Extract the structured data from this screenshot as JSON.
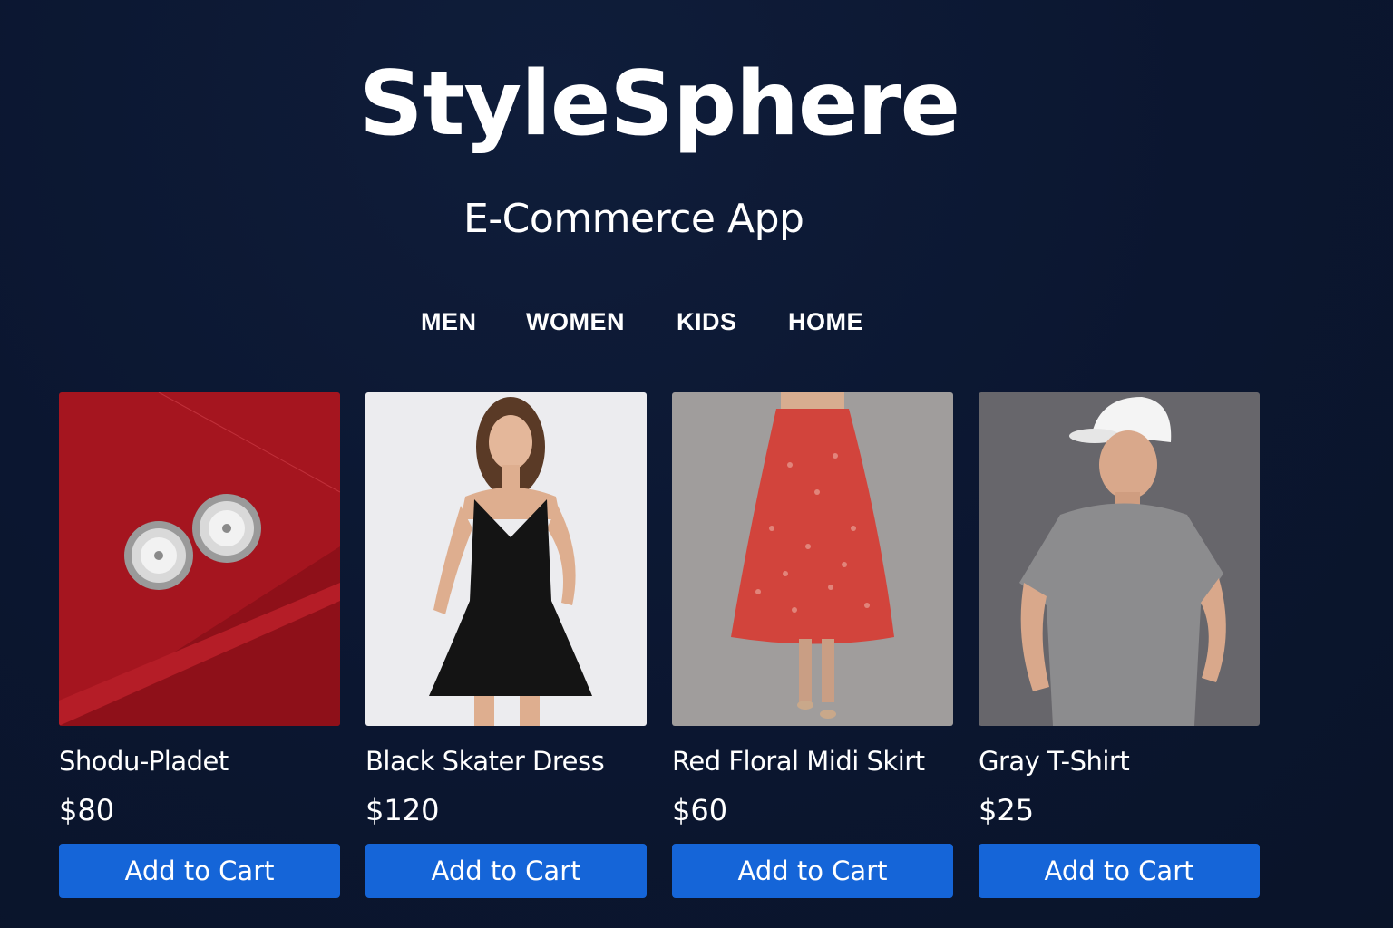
{
  "header": {
    "title": "StyleSphere",
    "subtitle": "E-Commerce App"
  },
  "nav": {
    "items": [
      {
        "label": "MEN"
      },
      {
        "label": "WOMEN"
      },
      {
        "label": "KIDS"
      },
      {
        "label": "HOME"
      }
    ]
  },
  "products": [
    {
      "name": "Shodu-Pladet",
      "price": "$80",
      "button": "Add to Cart",
      "image": "silver-stud-earrings-photo"
    },
    {
      "name": "Black Skater Dress",
      "price": "$120",
      "button": "Add to Cart",
      "image": "woman-black-dress-photo"
    },
    {
      "name": "Red Floral Midi Skirt",
      "price": "$60",
      "button": "Add to Cart",
      "image": "red-floral-skirt-photo"
    },
    {
      "name": "Gray T-Shirt",
      "price": "$25",
      "button": "Add to Cart",
      "image": "man-gray-tshirt-cap-photo"
    }
  ],
  "colors": {
    "background": "#0b1730",
    "button": "#1565d8",
    "text": "#ffffff"
  }
}
